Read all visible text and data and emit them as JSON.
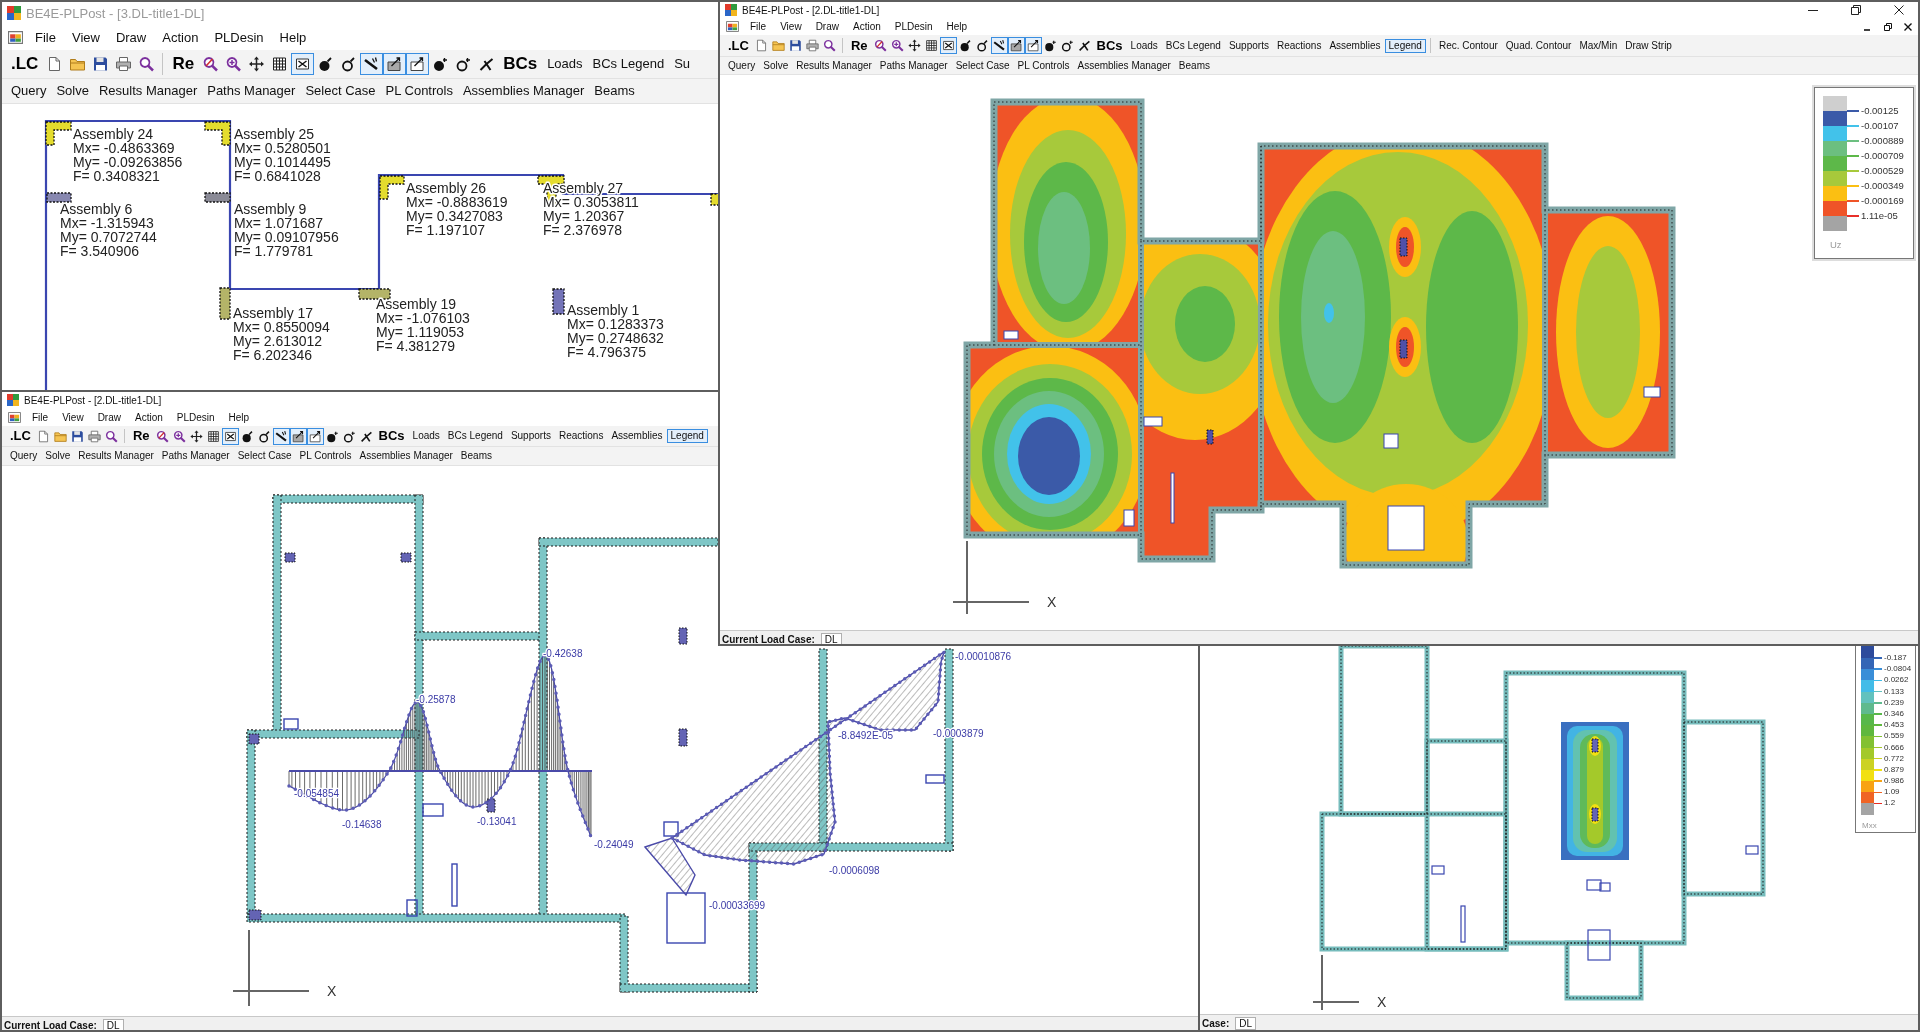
{
  "windows": [
    {
      "kind": "assemblies",
      "title": "BE4E-PLPost - [3.DL-title1-DL]",
      "active": false,
      "menu": [
        "File",
        "View",
        "Draw",
        "Action",
        "PLDesin",
        "Help"
      ],
      "toolbar": [
        {
          "kind": "bold",
          "label": ".LC",
          "selected": false
        },
        {
          "kind": "icon",
          "selected": false
        },
        {
          "kind": "icon",
          "selected": false
        },
        {
          "kind": "icon",
          "selected": false
        },
        {
          "kind": "icon",
          "selected": false
        },
        {
          "kind": "icon",
          "selected": false
        },
        {
          "kind": "separator"
        },
        {
          "kind": "bold",
          "label": "Re",
          "selected": false
        },
        {
          "kind": "icon",
          "selected": false
        },
        {
          "kind": "icon",
          "selected": false
        },
        {
          "kind": "icon",
          "selected": false
        },
        {
          "kind": "icon",
          "selected": false
        },
        {
          "kind": "icon",
          "selected": true
        },
        {
          "kind": "icon",
          "selected": false
        },
        {
          "kind": "icon",
          "selected": false
        },
        {
          "kind": "icon",
          "selected": true
        },
        {
          "kind": "icon",
          "selected": true
        },
        {
          "kind": "icon",
          "selected": true
        },
        {
          "kind": "icon",
          "selected": false
        },
        {
          "kind": "icon",
          "selected": false
        },
        {
          "kind": "icon",
          "selected": false
        },
        {
          "kind": "bold",
          "label": "BCs",
          "selected": false
        },
        {
          "kind": "text",
          "label": "Loads",
          "selected": false
        },
        {
          "kind": "text",
          "label": "BCs Legend",
          "selected": false
        },
        {
          "kind": "text",
          "label": "Su",
          "selected": false
        }
      ],
      "toolbar_2": [
        "Query",
        "Solve",
        "Results Manager",
        "Paths Manager",
        "Select Case",
        "PL Controls",
        "Assemblies Manager",
        "Beams"
      ],
      "assemblies": [
        {
          "name": "Assembly 24",
          "mx": "Mx= -0.4863369",
          "my": "My= -0.09263856",
          "f": "F= 0.3408321"
        },
        {
          "name": "Assembly 25",
          "mx": "Mx= 0.5280501",
          "my": "My= 0.1014495",
          "f": "F= 0.6841028"
        },
        {
          "name": "Assembly 26",
          "mx": "Mx= -0.8883619",
          "my": "My= 0.3427083",
          "f": "F= 1.197107"
        },
        {
          "name": "Assembly 27",
          "mx": "Mx= 0.3053811",
          "my": "My= 1.20367",
          "f": "F= 2.376978"
        },
        {
          "name": "Assembly 6",
          "mx": "Mx= -1.315943",
          "my": "My= 0.7072744",
          "f": "F= 3.540906"
        },
        {
          "name": "Assembly 9",
          "mx": "Mx= 1.071687",
          "my": "My= 0.09107956",
          "f": "F= 1.779781"
        },
        {
          "name": "Assembly 17",
          "mx": "Mx= 0.8550094",
          "my": "My= 2.613012",
          "f": "F= 6.202346"
        },
        {
          "name": "Assembly 19",
          "mx": "Mx= -1.076103",
          "my": "My= 1.119053",
          "f": "F= 4.381279"
        },
        {
          "name": "Assembly 1",
          "mx": "Mx= 0.1283373",
          "my": "My= 0.2748632",
          "f": "F= 4.796375"
        }
      ]
    },
    {
      "kind": "contour",
      "title": "BE4E-PLPost - [2.DL-title1-DL]",
      "active": true,
      "menu": [
        "File",
        "View",
        "Draw",
        "Action",
        "PLDesin",
        "Help"
      ],
      "toolbar": [
        {
          "kind": "bold",
          "label": ".LC",
          "selected": false
        },
        {
          "kind": "icon",
          "selected": false
        },
        {
          "kind": "icon",
          "selected": false
        },
        {
          "kind": "icon",
          "selected": false
        },
        {
          "kind": "icon",
          "selected": false
        },
        {
          "kind": "icon",
          "selected": false
        },
        {
          "kind": "separator"
        },
        {
          "kind": "bold",
          "label": "Re",
          "selected": false
        },
        {
          "kind": "icon",
          "selected": false
        },
        {
          "kind": "icon",
          "selected": false
        },
        {
          "kind": "icon",
          "selected": false
        },
        {
          "kind": "icon",
          "selected": false
        },
        {
          "kind": "icon",
          "selected": true
        },
        {
          "kind": "icon",
          "selected": false
        },
        {
          "kind": "icon",
          "selected": false
        },
        {
          "kind": "icon",
          "selected": true
        },
        {
          "kind": "icon",
          "selected": true
        },
        {
          "kind": "icon",
          "selected": true
        },
        {
          "kind": "icon",
          "selected": false
        },
        {
          "kind": "icon",
          "selected": false
        },
        {
          "kind": "icon",
          "selected": false
        },
        {
          "kind": "bold",
          "label": "BCs",
          "selected": false
        },
        {
          "kind": "text",
          "label": "Loads",
          "selected": false
        },
        {
          "kind": "text",
          "label": "BCs Legend",
          "selected": false
        },
        {
          "kind": "text",
          "label": "Supports",
          "selected": false
        },
        {
          "kind": "text",
          "label": "Reactions",
          "selected": false
        },
        {
          "kind": "text",
          "label": "Assemblies",
          "selected": false
        },
        {
          "kind": "text",
          "label": "Legend",
          "selected": true
        },
        {
          "kind": "separator"
        },
        {
          "kind": "text",
          "label": "Rec. Contour",
          "selected": false
        },
        {
          "kind": "text",
          "label": "Quad. Contour",
          "selected": false
        },
        {
          "kind": "text",
          "label": "Max/Min",
          "selected": false
        },
        {
          "kind": "text",
          "label": "Draw Strip",
          "selected": false
        }
      ],
      "toolbar_2": [
        "Query",
        "Solve",
        "Results Manager",
        "Paths Manager",
        "Select Case",
        "PL Controls",
        "Assemblies Manager",
        "Beams"
      ],
      "legend": {
        "title": "Uz",
        "items": [
          {
            "label": "-0.00125",
            "color": "#3b5aa8"
          },
          {
            "label": "-0.00107",
            "color": "#42c2ea"
          },
          {
            "label": "-0.000889",
            "color": "#6cbf80"
          },
          {
            "label": "-0.000709",
            "color": "#5db849"
          },
          {
            "label": "-0.000529",
            "color": "#a7c93b"
          },
          {
            "label": "-0.000349",
            "color": "#fbbf12"
          },
          {
            "label": "-0.000169",
            "color": "#ef5428"
          },
          {
            "label": "1.11e-05",
            "color": "#e8302a"
          }
        ]
      },
      "axis_label": "X",
      "status": {
        "label": "Current Load Case:",
        "value": "DL"
      }
    },
    {
      "kind": "beams",
      "title": "BE4E-PLPost - [2.DL-title1-DL]",
      "active": true,
      "menu": [
        "File",
        "View",
        "Draw",
        "Action",
        "PLDesin",
        "Help"
      ],
      "toolbar": [
        {
          "kind": "bold",
          "label": ".LC",
          "selected": false
        },
        {
          "kind": "icon",
          "selected": false
        },
        {
          "kind": "icon",
          "selected": false
        },
        {
          "kind": "icon",
          "selected": false
        },
        {
          "kind": "icon",
          "selected": false
        },
        {
          "kind": "icon",
          "selected": false
        },
        {
          "kind": "separator"
        },
        {
          "kind": "bold",
          "label": "Re",
          "selected": false
        },
        {
          "kind": "icon",
          "selected": false
        },
        {
          "kind": "icon",
          "selected": false
        },
        {
          "kind": "icon",
          "selected": false
        },
        {
          "kind": "icon",
          "selected": false
        },
        {
          "kind": "icon",
          "selected": true
        },
        {
          "kind": "icon",
          "selected": false
        },
        {
          "kind": "icon",
          "selected": false
        },
        {
          "kind": "icon",
          "selected": true
        },
        {
          "kind": "icon",
          "selected": true
        },
        {
          "kind": "icon",
          "selected": true
        },
        {
          "kind": "icon",
          "selected": false
        },
        {
          "kind": "icon",
          "selected": false
        },
        {
          "kind": "icon",
          "selected": false
        },
        {
          "kind": "bold",
          "label": "BCs",
          "selected": false
        },
        {
          "kind": "text",
          "label": "Loads",
          "selected": false
        },
        {
          "kind": "text",
          "label": "BCs Legend",
          "selected": false
        },
        {
          "kind": "text",
          "label": "Supports",
          "selected": false
        },
        {
          "kind": "text",
          "label": "Reactions",
          "selected": false
        },
        {
          "kind": "text",
          "label": "Assemblies",
          "selected": false
        },
        {
          "kind": "text",
          "label": "Legend",
          "selected": true
        }
      ],
      "toolbar_2": [
        "Query",
        "Solve",
        "Results Manager",
        "Paths Manager",
        "Select Case",
        "PL Controls",
        "Assemblies Manager",
        "Beams"
      ],
      "moment_labels": [
        "-0.00010876",
        "-0.42638",
        "-0.25878",
        "-0.0003879",
        "-8.8492E-05",
        "-0.054854",
        "-0.13041",
        "-0.14638",
        "-0.24049",
        "-0.0006098",
        "-0.00033699"
      ],
      "axis_label": "X",
      "status": {
        "label": "Current Load Case:",
        "value": "DL"
      }
    },
    {
      "kind": "mxx",
      "legend": {
        "title": "Mxx",
        "items": [
          {
            "label": "-0.187",
            "color": "#3466b6"
          },
          {
            "label": "-0.0804",
            "color": "#3a8ed8"
          },
          {
            "label": "0.0262",
            "color": "#42bce8"
          },
          {
            "label": "0.133",
            "color": "#62c2be"
          },
          {
            "label": "0.239",
            "color": "#5fba8e"
          },
          {
            "label": "0.346",
            "color": "#58b84a"
          },
          {
            "label": "0.453",
            "color": "#5fb83e"
          },
          {
            "label": "0.559",
            "color": "#82c132"
          },
          {
            "label": "0.666",
            "color": "#a4c92a"
          },
          {
            "label": "0.772",
            "color": "#ccd222"
          },
          {
            "label": "0.879",
            "color": "#f2e012"
          },
          {
            "label": "0.986",
            "color": "#f8a314"
          },
          {
            "label": "1.09",
            "color": "#f06424"
          },
          {
            "label": "1.2",
            "color": "#e82a22"
          }
        ]
      },
      "axis_label": "X",
      "status": {
        "label": "Case:",
        "value": "DL"
      }
    }
  ]
}
